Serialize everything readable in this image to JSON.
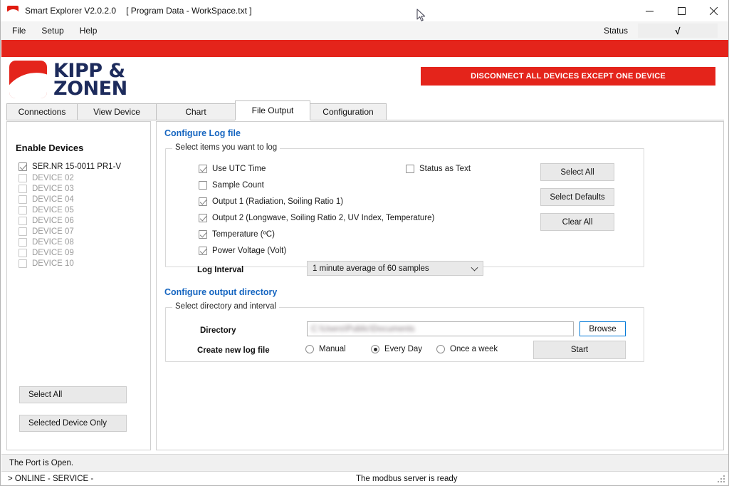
{
  "window": {
    "app_icon": "kipp-zonen-logo-icon",
    "title": "Smart Explorer V2.0.2.0",
    "subtitle": "[ Program Data - WorkSpace.txt ]",
    "controls": {
      "minimize": "minimize-icon",
      "maximize": "maximize-icon",
      "close": "close-icon"
    }
  },
  "menubar": {
    "items": [
      "File",
      "Setup",
      "Help"
    ],
    "status_label": "Status",
    "status_value": "√"
  },
  "header": {
    "logo_line1": "KIPP &",
    "logo_line2": "ZONEN",
    "banner_text": "DISCONNECT ALL DEVICES EXCEPT ONE DEVICE",
    "banner_color": "#e4241b",
    "stripe_color": "#e4241b"
  },
  "tabs": [
    {
      "label": "Connections",
      "active": false
    },
    {
      "label": "View Device",
      "active": false
    },
    {
      "label": "Chart",
      "active": false
    },
    {
      "label": "File Output",
      "active": true
    },
    {
      "label": "Configuration",
      "active": false
    }
  ],
  "sidebar": {
    "title": "Enable Devices",
    "devices": [
      {
        "label": "SER.NR 15-0011 PR1-V",
        "checked": true,
        "enabled": true
      },
      {
        "label": "DEVICE 02",
        "checked": false,
        "enabled": false
      },
      {
        "label": "DEVICE 03",
        "checked": false,
        "enabled": false
      },
      {
        "label": "DEVICE 04",
        "checked": false,
        "enabled": false
      },
      {
        "label": "DEVICE 05",
        "checked": false,
        "enabled": false
      },
      {
        "label": "DEVICE 06",
        "checked": false,
        "enabled": false
      },
      {
        "label": "DEVICE 07",
        "checked": false,
        "enabled": false
      },
      {
        "label": "DEVICE 08",
        "checked": false,
        "enabled": false
      },
      {
        "label": "DEVICE 09",
        "checked": false,
        "enabled": false
      },
      {
        "label": "DEVICE 10",
        "checked": false,
        "enabled": false
      }
    ],
    "select_all_label": "Select All",
    "selected_device_only_label": "Selected Device Only"
  },
  "log_file": {
    "section_title": "Configure Log file",
    "group_legend": "Select items you want to log",
    "items": [
      {
        "label": "Use UTC Time",
        "checked": true
      },
      {
        "label": "Sample Count",
        "checked": false
      },
      {
        "label": "Output 1 (Radiation, Soiling Ratio 1)",
        "checked": true
      },
      {
        "label": "Output 2 (Longwave, Soiling Ratio 2, UV Index, Temperature)",
        "checked": true
      },
      {
        "label": "Temperature (ºC)",
        "checked": true
      },
      {
        "label": "Power Voltage (Volt)",
        "checked": true
      }
    ],
    "status_as_text": {
      "label": "Status as Text",
      "checked": false
    },
    "log_interval_label": "Log Interval",
    "log_interval_value": "1 minute average of 60 samples",
    "buttons": {
      "select_all": "Select All",
      "select_defaults": "Select Defaults",
      "clear_all": "Clear All"
    }
  },
  "output_dir": {
    "section_title": "Configure output directory",
    "group_legend": "Select directory and interval",
    "directory_label": "Directory",
    "directory_value": "C:\\Users\\Public\\Documents",
    "browse_label": "Browse",
    "create_new_label": "Create new log file",
    "intervals": [
      {
        "label": "Manual",
        "checked": false
      },
      {
        "label": "Every Day",
        "checked": true
      },
      {
        "label": "Once a week",
        "checked": false
      }
    ],
    "start_label": "Start"
  },
  "statusbar": {
    "port_text": "The Port is Open.",
    "mode_text": "> ONLINE  - SERVICE -",
    "server_text": "The modbus server is ready"
  }
}
